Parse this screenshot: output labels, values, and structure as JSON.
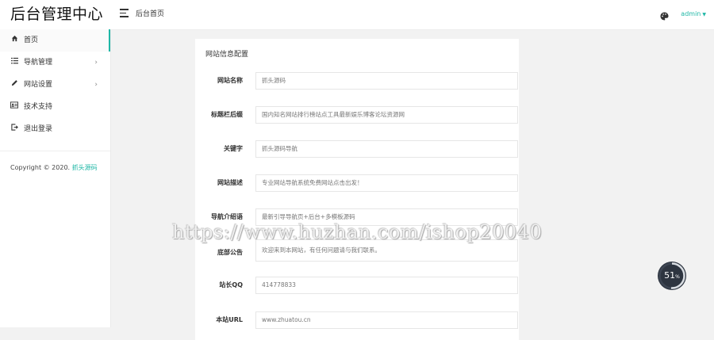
{
  "brand": "后台管理中心",
  "header": {
    "breadcrumb": "后台首页",
    "user": "admin",
    "icons": {
      "menu": "menu-icon",
      "palette": "palette-icon"
    }
  },
  "sidebar": {
    "items": [
      {
        "label": "首页",
        "icon": "home-icon",
        "active": true,
        "has_arrow": false
      },
      {
        "label": "导航管理",
        "icon": "list-icon",
        "active": false,
        "has_arrow": true
      },
      {
        "label": "网站设置",
        "icon": "edit-icon",
        "active": false,
        "has_arrow": true
      },
      {
        "label": "技术支持",
        "icon": "id-card-icon",
        "active": false,
        "has_arrow": false
      },
      {
        "label": "退出登录",
        "icon": "logout-icon",
        "active": false,
        "has_arrow": false
      }
    ],
    "copyright": "Copyright © 2020.",
    "copyright_link": "抓头源码"
  },
  "card": {
    "title": "网站信息配置",
    "fields": [
      {
        "label": "网站名称",
        "value": "抓头源码"
      },
      {
        "label": "标题栏后缀",
        "value": "国内知名网站排行榜站点工具最新娱乐博客论坛资源网"
      },
      {
        "label": "关键字",
        "value": "抓头源码导航"
      },
      {
        "label": "网站描述",
        "value": "专业网站导航系统免费网站点击出发！"
      },
      {
        "label": "导航介绍语",
        "value": "最新引导导航页+后台+多模板源码"
      },
      {
        "label": "底部公告",
        "value": "欢迎来到本网站，有任何问题请与我们联系。"
      },
      {
        "label": "站长QQ",
        "value": "414778833"
      },
      {
        "label": "本站URL",
        "value": "www.zhuatou.cn"
      }
    ]
  },
  "watermark": "https://www.huzhan.com/ishop20040",
  "progress": {
    "value": "51",
    "unit": "%",
    "fraction": 0.51
  },
  "colors": {
    "accent": "#1fb7a6",
    "badge": "#2e3540"
  }
}
